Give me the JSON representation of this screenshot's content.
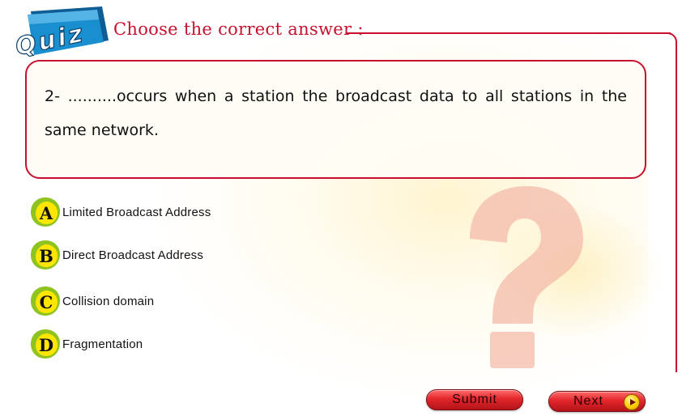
{
  "badge": {
    "label": "Quiz"
  },
  "heading": "Choose the correct answer :",
  "question": {
    "text": "2- ..........occurs when a station the broadcast data to all stations in the same network."
  },
  "options": [
    {
      "letter": "A",
      "label": "Limited Broadcast Address"
    },
    {
      "letter": "B",
      "label": "Direct Broadcast Address"
    },
    {
      "letter": "C",
      "label": "Collision domain"
    },
    {
      "letter": "D",
      "label": "Fragmentation"
    }
  ],
  "buttons": {
    "submit": "Submit",
    "next": "Next"
  },
  "colors": {
    "accent": "#c8102e",
    "badge_blue": "#1a7fc0",
    "option_green": "#8fc31f",
    "option_yellow": "#ffe600",
    "question_mark": "#f2b8a8"
  },
  "icons": {
    "option_badge": "lettered-leaf-icon",
    "decoration": "question-mark-icon",
    "next": "play-arrow-icon"
  }
}
